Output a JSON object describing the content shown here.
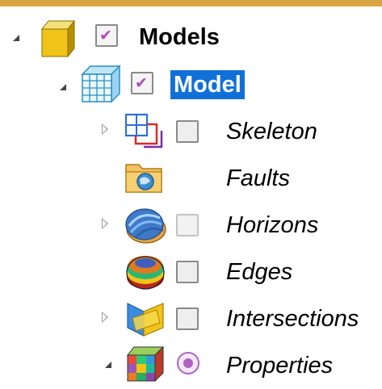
{
  "tree": {
    "root": {
      "label": "Models",
      "checked": true
    },
    "model": {
      "label": "Model",
      "checked": true,
      "selected": true
    },
    "children": [
      {
        "label": "Skeleton",
        "icon": "skeleton-icon",
        "expander": "collapsed"
      },
      {
        "label": "Faults",
        "icon": "faults-folder-icon",
        "expander": "none"
      },
      {
        "label": "Horizons",
        "icon": "horizons-icon",
        "expander": "collapsed"
      },
      {
        "label": "Edges",
        "icon": "edges-icon",
        "expander": "none"
      },
      {
        "label": "Intersections",
        "icon": "intersections-icon",
        "expander": "collapsed"
      },
      {
        "label": "Properties",
        "icon": "properties-icon",
        "expander": "expanded"
      }
    ]
  },
  "colors": {
    "selection": "#1170d8",
    "top_border": "#d9a441"
  }
}
